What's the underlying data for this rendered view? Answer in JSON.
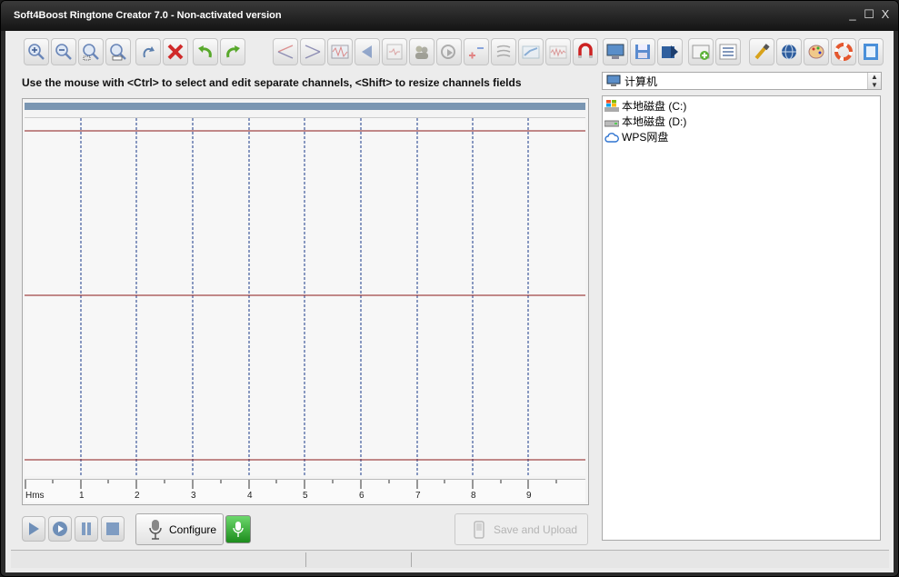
{
  "window": {
    "title": "Soft4Boost Ringtone Creator 7.0 - Non-activated version",
    "controls": {
      "minimize": "_",
      "maximize": "☐",
      "close": "X"
    }
  },
  "hint": "Use the mouse with <Ctrl> to select and edit separate channels, <Shift> to resize channels fields",
  "toolbar_icons": [
    "zoom-in-icon",
    "zoom-out-icon",
    "zoom-selection-icon",
    "zoom-100-icon",
    "undo-marker-icon",
    "delete-icon",
    "undo-icon",
    "redo-icon",
    "fade-in-icon",
    "fade-out-icon",
    "normalize-icon",
    "reverse-icon",
    "silence-icon",
    "voice-icon",
    "insert-icon",
    "volume-icon",
    "echo-icon",
    "amplify-icon",
    "noise-icon",
    "magnet-icon"
  ],
  "right_toolbar_icons": [
    "computer-icon",
    "save-icon",
    "export-icon",
    "add-file-icon",
    "list-icon",
    "settings-icon",
    "web-icon",
    "skin-icon",
    "help-icon",
    "info-icon"
  ],
  "ruler": {
    "unit": "Hms",
    "labels": [
      "1",
      "2",
      "3",
      "4",
      "5",
      "6",
      "7",
      "8",
      "9"
    ]
  },
  "player": {
    "configure_label": "Configure",
    "save_upload_label": "Save and Upload"
  },
  "drive_combo": {
    "value": "计算机"
  },
  "tree": [
    {
      "label": "本地磁盘 (C:)",
      "icon": "windows-drive-icon"
    },
    {
      "label": "本地磁盘 (D:)",
      "icon": "drive-icon"
    },
    {
      "label": "WPS网盘",
      "icon": "cloud-icon"
    }
  ],
  "colors": {
    "titlebar": "#141414",
    "overview": "#7a96b2",
    "channel_line": "#8b1a1a",
    "grid_line": "#1a3a8a"
  }
}
